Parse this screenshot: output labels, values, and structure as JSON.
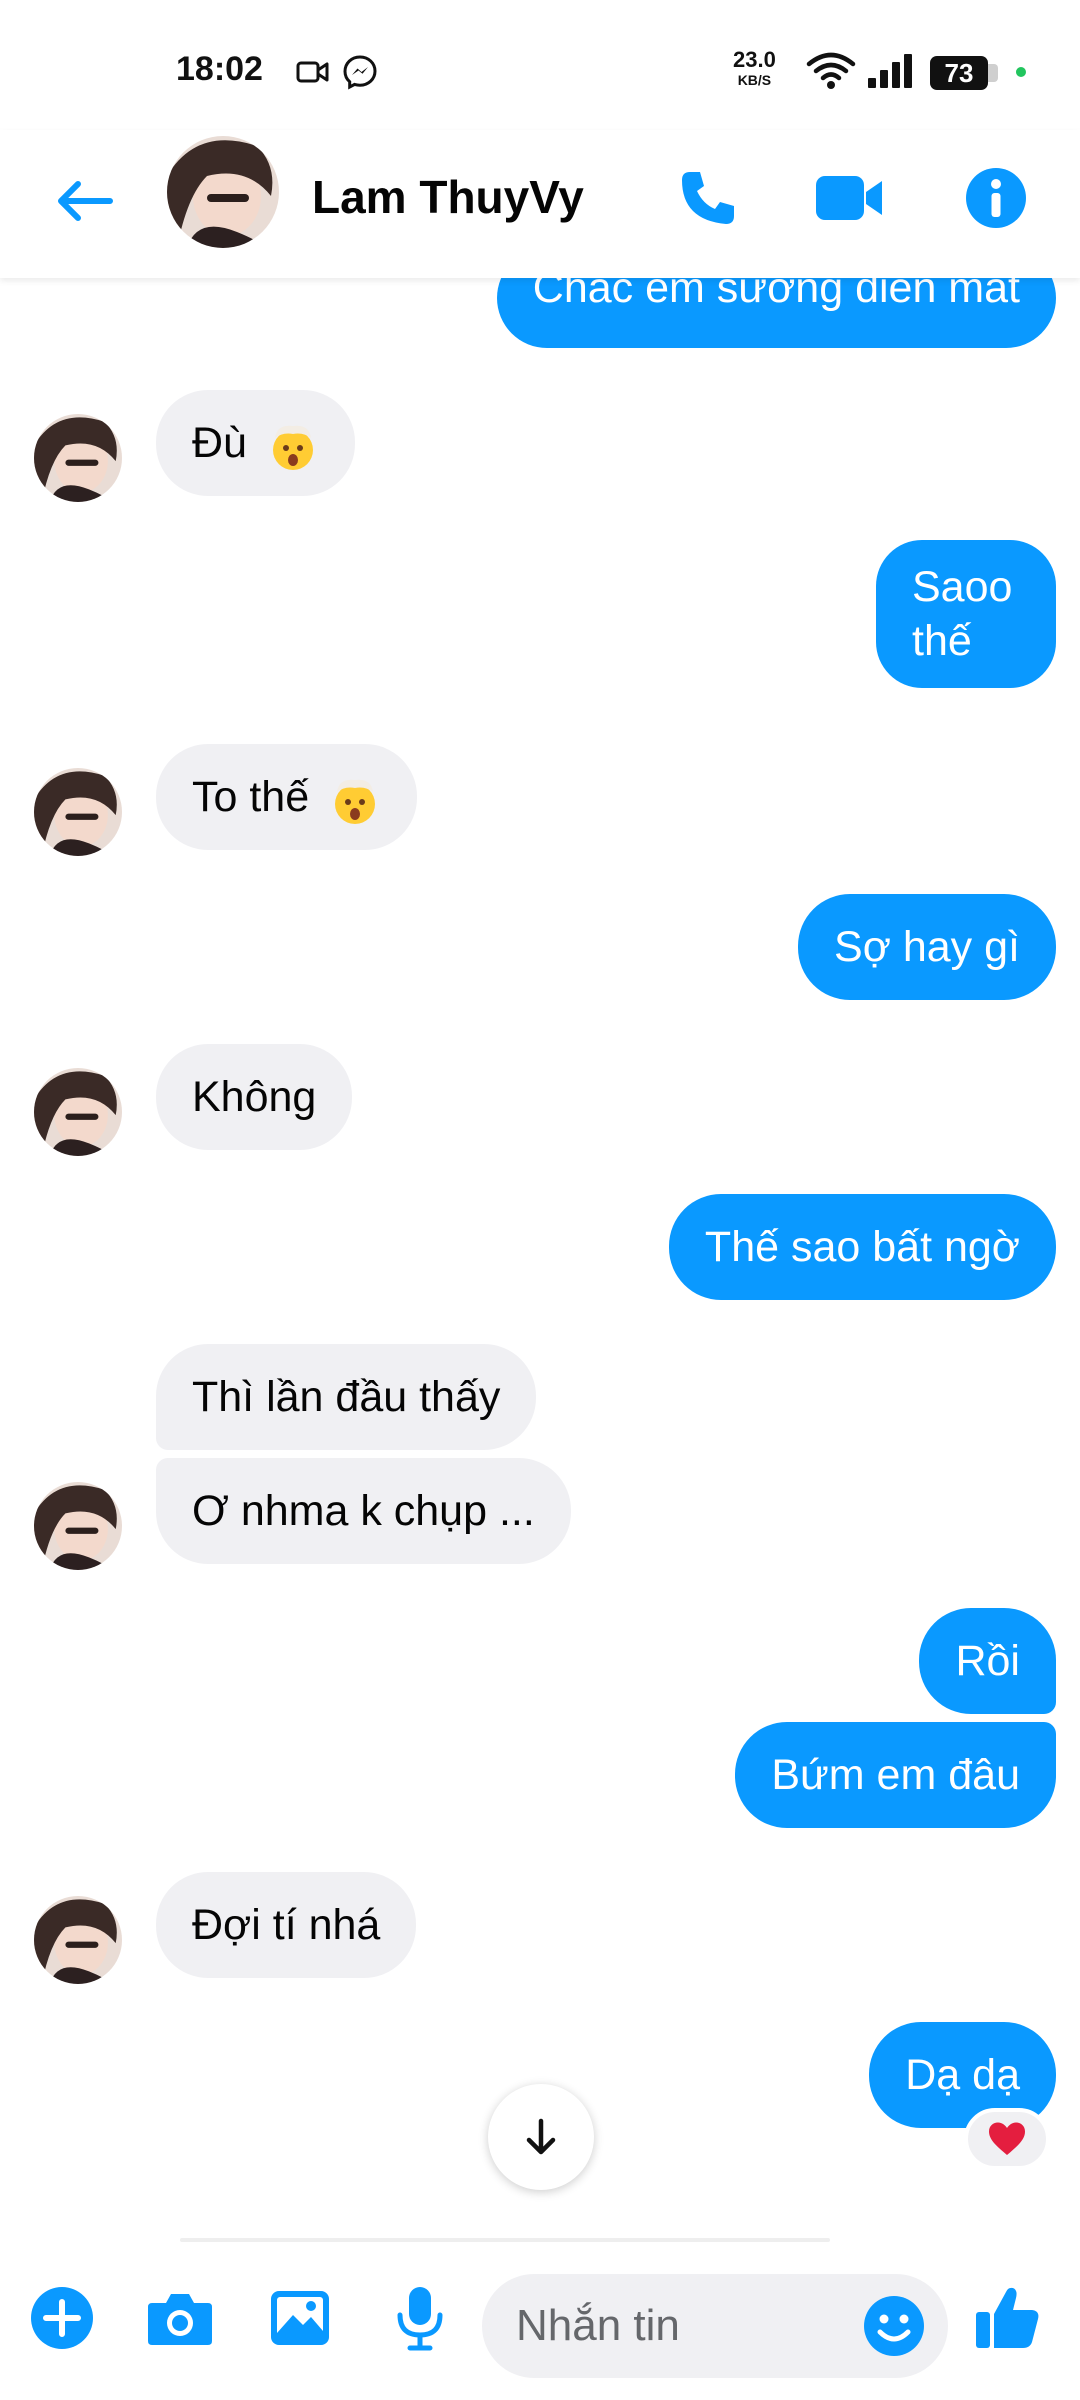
{
  "status_bar": {
    "time": "18:02",
    "speed_value": "23.0",
    "speed_unit": "KB/S",
    "battery": "73",
    "icons": [
      "video-record-icon",
      "messenger-icon",
      "wifi-icon",
      "signal-icon",
      "battery-icon"
    ]
  },
  "header": {
    "contact_name": "Lam ThuyVy",
    "buttons": [
      "back-arrow-icon",
      "phone-call-icon",
      "video-call-icon",
      "info-icon"
    ],
    "accent_color": "#0a99ff"
  },
  "messages": [
    {
      "side": "out",
      "text": "Chắc em sướng điên mất"
    },
    {
      "side": "in",
      "text": "Đù",
      "emoji": "exploding-head"
    },
    {
      "side": "out",
      "text": "Saoo thế"
    },
    {
      "side": "in",
      "text": "To thế",
      "emoji": "exploding-head"
    },
    {
      "side": "out",
      "text": "Sợ hay gì"
    },
    {
      "side": "in",
      "text": "Không"
    },
    {
      "side": "out",
      "text": "Thế sao bất ngờ"
    },
    {
      "side": "in",
      "text": "Thì lần đầu thấy"
    },
    {
      "side": "in",
      "text": "Ơ nhma k chụp ..."
    },
    {
      "side": "out",
      "text": "Rồi"
    },
    {
      "side": "out",
      "text": "Bứm em đâu"
    },
    {
      "side": "in",
      "text": "Đợi tí nhá"
    },
    {
      "side": "out",
      "text": "Dạ dạ",
      "reaction": "heart"
    }
  ],
  "composer": {
    "placeholder": "Nhắn tin",
    "buttons": [
      "plus-icon",
      "camera-icon",
      "gallery-icon",
      "microphone-icon",
      "emoji-icon",
      "like-icon"
    ]
  },
  "colors": {
    "outgoing_bubble": "#0a99ff",
    "incoming_bubble": "#f0f0f3",
    "icon_blue": "#0a99ff"
  }
}
